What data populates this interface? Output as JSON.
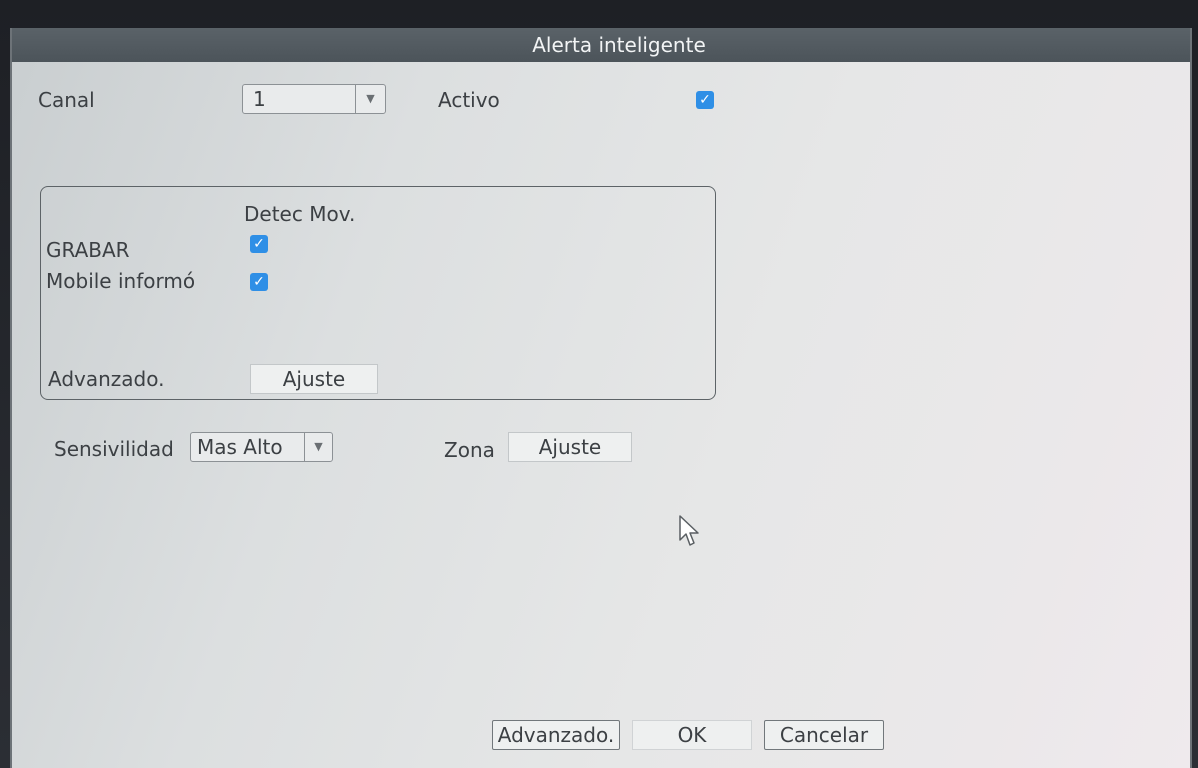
{
  "dialog": {
    "title": "Alerta inteligente"
  },
  "channel": {
    "label": "Canal",
    "value": "1"
  },
  "active": {
    "label": "Activo",
    "checked": true
  },
  "group": {
    "column_header": "Detec Mov.",
    "rows": [
      {
        "label": "GRABAR",
        "checked": true
      },
      {
        "label": "Mobile informó",
        "checked": true
      }
    ],
    "advanced_label": "Advanzado.",
    "advanced_button": "Ajuste"
  },
  "sensitivity": {
    "label": "Sensivilidad",
    "value": "Mas Alto"
  },
  "zone": {
    "label": "Zona",
    "button": "Ajuste"
  },
  "footer": {
    "advanced_button": "Advanzado.",
    "ok_button": "OK",
    "cancel_button": "Cancelar"
  },
  "icons": {
    "checkmark": "check-icon",
    "dropdown": "chevron-down-icon",
    "cursor": "mouse-pointer-icon"
  },
  "colors": {
    "titlebar": "#4f575d",
    "checkbox": "#2f8fe6",
    "dialog_bg": "#e2e4e4"
  }
}
